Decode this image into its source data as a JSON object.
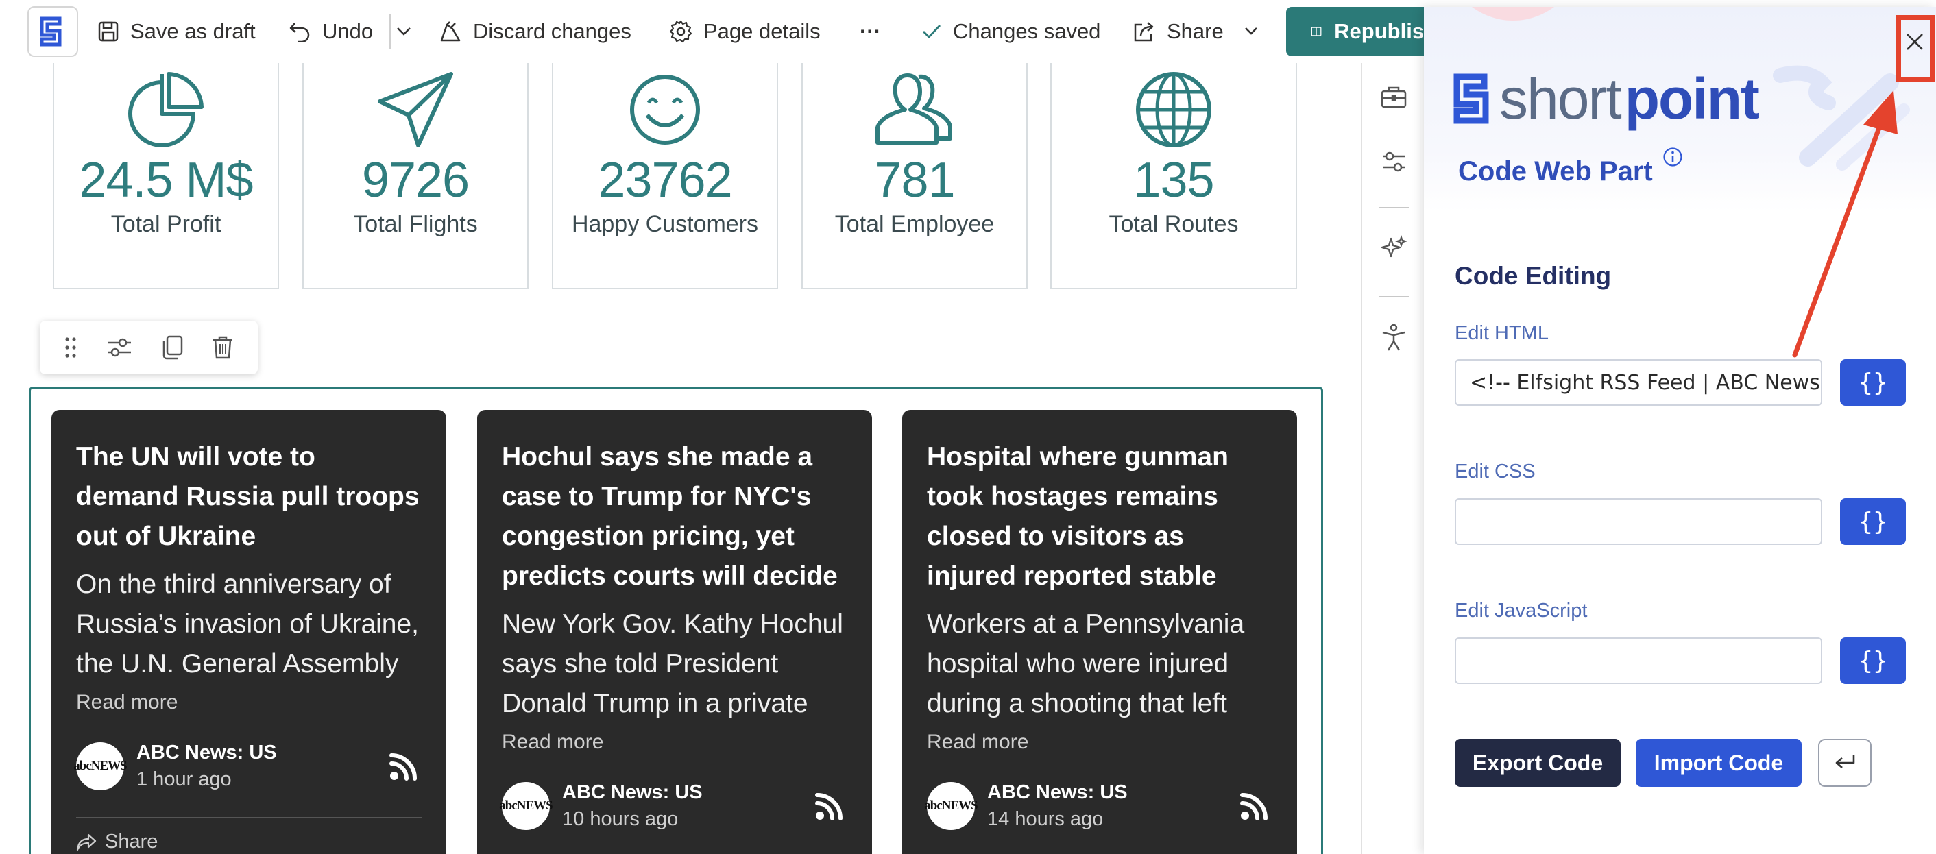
{
  "toolbar": {
    "save_draft": "Save as draft",
    "undo": "Undo",
    "discard": "Discard changes",
    "page_details": "Page details",
    "more": "···",
    "changes_saved": "Changes saved",
    "share": "Share",
    "republish": "Republish"
  },
  "stats": [
    {
      "icon": "pie-chart-icon",
      "value": "24.5 M$",
      "label": "Total Profit"
    },
    {
      "icon": "paper-plane-icon",
      "value": "9726",
      "label": "Total Flights"
    },
    {
      "icon": "smiley-icon",
      "value": "23762",
      "label": "Happy Customers"
    },
    {
      "icon": "users-icon",
      "value": "781",
      "label": "Total Employee"
    },
    {
      "icon": "globe-icon",
      "value": "135",
      "label": "Total Routes"
    }
  ],
  "news": [
    {
      "title": "The UN will vote to demand Russia pull troops out of Ukraine",
      "excerpt": "On the third anniversary of Russia’s invasion of Ukraine, the U.N. General Assembly is",
      "read_more": "Read more",
      "source": "ABC News: US",
      "time": "1 hour ago",
      "logo": "abcNEWS",
      "share": "Share"
    },
    {
      "title": "Hochul says she made a case to Trump for NYC's congestion pricing, yet predicts courts will decide",
      "excerpt": "New York Gov. Kathy Hochul says she told President Donald Trump in a private",
      "read_more": "Read more",
      "source": "ABC News: US",
      "time": "10 hours ago",
      "logo": "abcNEWS"
    },
    {
      "title": "Hospital where gunman took hostages remains closed to visitors as injured reported stable",
      "excerpt": "Workers at a Pennsylvania hospital who were injured during a shooting that left",
      "read_more": "Read more",
      "source": "ABC News: US",
      "time": "14 hours ago",
      "logo": "abcNEWS"
    }
  ],
  "panel": {
    "brand_short": "short",
    "brand_point": "point",
    "title": "Code Web Part",
    "section_title": "Code Editing",
    "html_label": "Edit HTML",
    "html_value": "<!-- Elfsight RSS Feed | ABC News",
    "css_label": "Edit CSS",
    "css_value": "",
    "js_label": "Edit JavaScript",
    "js_value": "",
    "code_btn": "{}",
    "export_label": "Export Code",
    "import_label": "Import Code"
  },
  "colors": {
    "teal": "#2b7a78",
    "stat_value": "#2f7d7e",
    "brand_blue": "#2f57d6",
    "annotation_red": "#e4432d",
    "card_bg": "#2a2a2a"
  }
}
